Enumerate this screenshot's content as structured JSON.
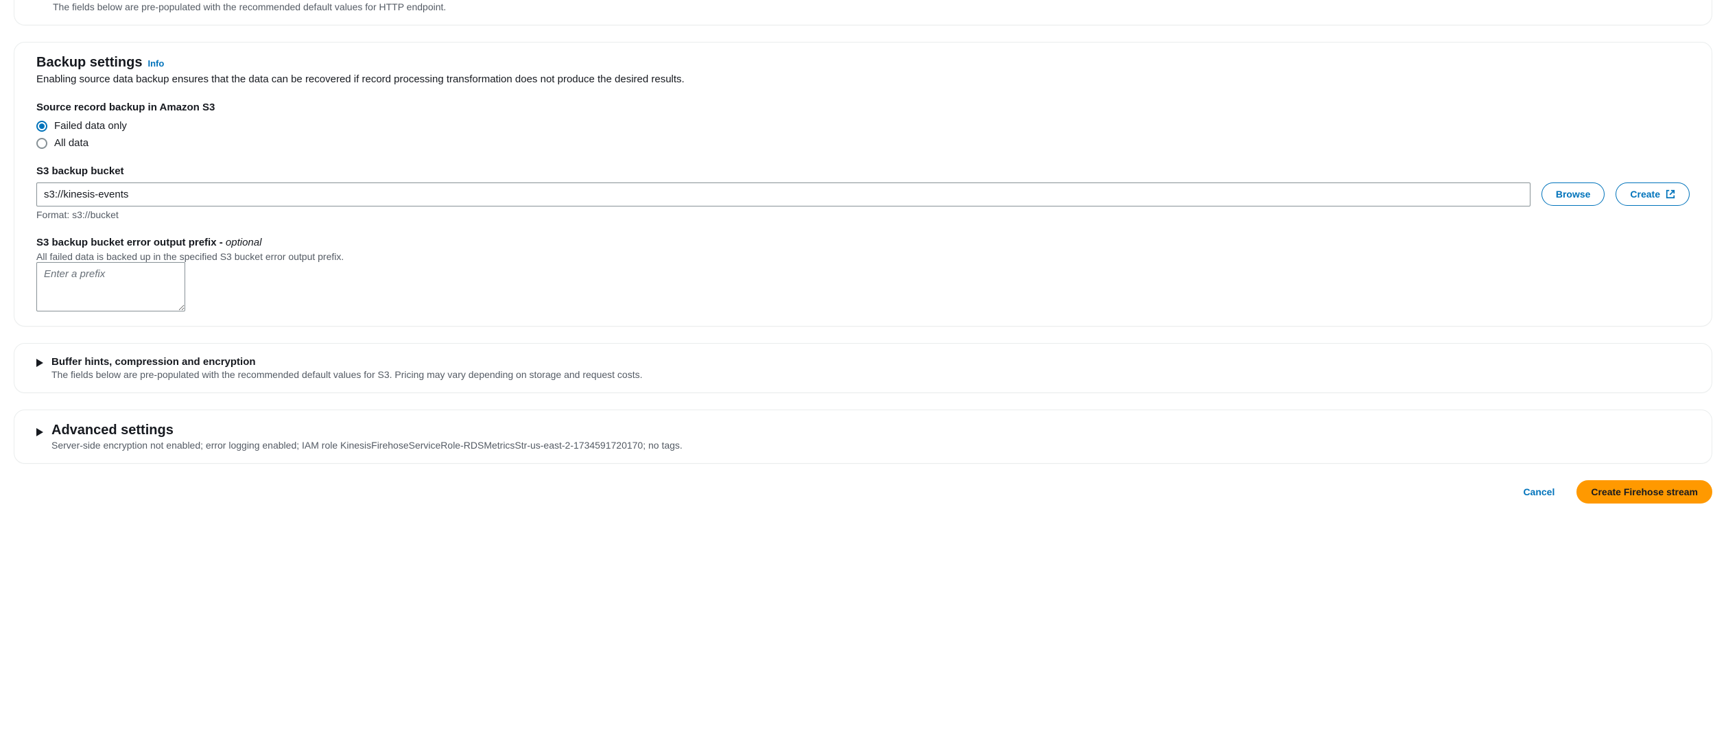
{
  "http_endpoint_panel": {
    "hint": "The fields below are pre-populated with the recommended default values for HTTP endpoint."
  },
  "backup": {
    "heading": "Backup settings",
    "info_label": "Info",
    "description": "Enabling source data backup ensures that the data can be recovered if record processing transformation does not produce the desired results.",
    "source_record_label": "Source record backup in Amazon S3",
    "options": {
      "failed": "Failed data only",
      "all": "All data"
    },
    "bucket": {
      "label": "S3 backup bucket",
      "value": "s3://kinesis-events",
      "format_hint": "Format: s3://bucket",
      "browse_label": "Browse",
      "create_label": "Create"
    },
    "prefix": {
      "label_main": "S3 backup bucket error output prefix - ",
      "label_optional": "optional",
      "hint": "All failed data is backed up in the specified S3 bucket error output prefix.",
      "placeholder": "Enter a prefix"
    }
  },
  "buffer_panel": {
    "title": "Buffer hints, compression and encryption",
    "hint": "The fields below are pre-populated with the recommended default values for S3. Pricing may vary depending on storage and request costs."
  },
  "advanced_panel": {
    "title": "Advanced settings",
    "hint": "Server-side encryption not enabled; error logging enabled; IAM role KinesisFirehoseServiceRole-RDSMetricsStr-us-east-2-1734591720170; no tags."
  },
  "footer": {
    "cancel": "Cancel",
    "create": "Create Firehose stream"
  }
}
